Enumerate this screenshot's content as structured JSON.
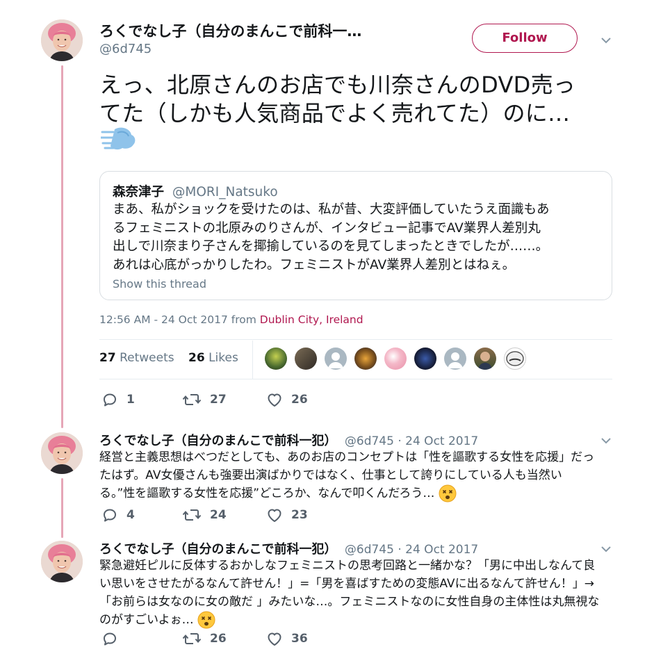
{
  "main_tweet": {
    "display_name": "ろくでなし子（自分のまんこで前科一…",
    "handle": "@6d745",
    "follow_label": "Follow",
    "text_line1": "えっ、北原さんのお店でも川奈さんのDVD売っ",
    "text_line2": "てた（しかも人気商品でよく売れてた）のに…",
    "emoji": "dashing-away-icon",
    "quote": {
      "name": "森奈津子",
      "handle": "@MORI_Natsuko",
      "lines": [
        "まあ、私がショックを受けたのは、私が昔、大変評価していたうえ面識もあ",
        "るフェミニストの北原みのりさんが、インタビュー記事でAV業界人差別丸",
        "出しで川奈まり子さんを揶揄しているのを見てしまったときでしたが……。",
        "あれは心底がっかりしたわ。フェミニストがAV業界人差別とはねぇ。"
      ],
      "show_thread": "Show this thread"
    },
    "timestamp": "12:56 AM - 24 Oct 2017 from ",
    "location": "Dublin City, Ireland",
    "retweets_count": "27",
    "retweets_label": "Retweets",
    "likes_count": "26",
    "likes_label": "Likes",
    "actions": {
      "replies": "1",
      "retweets": "27",
      "likes": "26"
    }
  },
  "replies": [
    {
      "display_name": "ろくでなし子（自分のまんこで前科一犯）",
      "handle": "@6d745",
      "date": "· 24 Oct 2017",
      "lines": [
        "経営と主義思想はべつだとしても、あのお店のコンセプトは「性を謳歌する女性を応援」だっ",
        "たはず。AV女優さんも強要出演ばかりではなく、仕事として誇りにしている人も当然い",
        "る。”性を謳歌する女性を応援”どころか、なんで叩くんだろう…"
      ],
      "emoji": "dizzy-face-icon",
      "actions": {
        "replies": "4",
        "retweets": "24",
        "likes": "23"
      }
    },
    {
      "display_name": "ろくでなし子（自分のまんこで前科一犯）",
      "handle": "@6d745",
      "date": "· 24 Oct 2017",
      "lines": [
        "緊急避妊ピルに反体するおかしなフェミニストの思考回路と一緒かな？「男に中出しなんて良",
        "い思いをさせたがるなんて許せん！」=「男を喜ばすための変態AVに出るなんて許せん！」→",
        "「お前らは女なのに女の敵だ 」みたいな…。フェミニストなのに女性自身の主体性は丸無視な",
        "のがすごいよぉ…"
      ],
      "emoji": "dizzy-face-icon",
      "actions": {
        "replies": "",
        "retweets": "26",
        "likes": "36"
      }
    }
  ],
  "colors": {
    "accent": "#b0174f",
    "thread_line": "#e6a6b7",
    "link": "#b0174f",
    "muted": "#657786"
  }
}
